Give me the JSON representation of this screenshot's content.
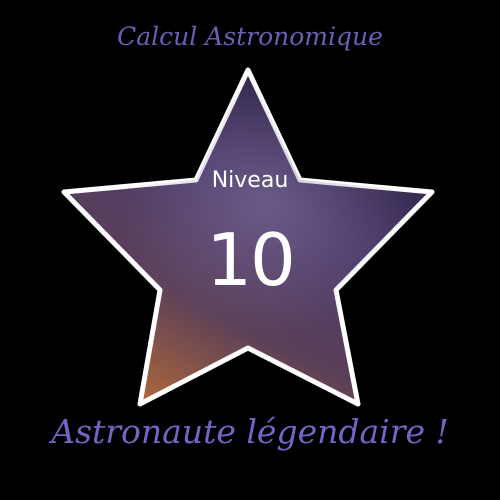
{
  "title": "Calcul Astronomique",
  "badge": {
    "label": "Niveau",
    "level": "10",
    "shape": "star"
  },
  "subtitle": "Astronaute légendaire !",
  "colors": {
    "text_accent": "#6b5fb5",
    "star_border": "#ffffff",
    "background": "#000000"
  }
}
